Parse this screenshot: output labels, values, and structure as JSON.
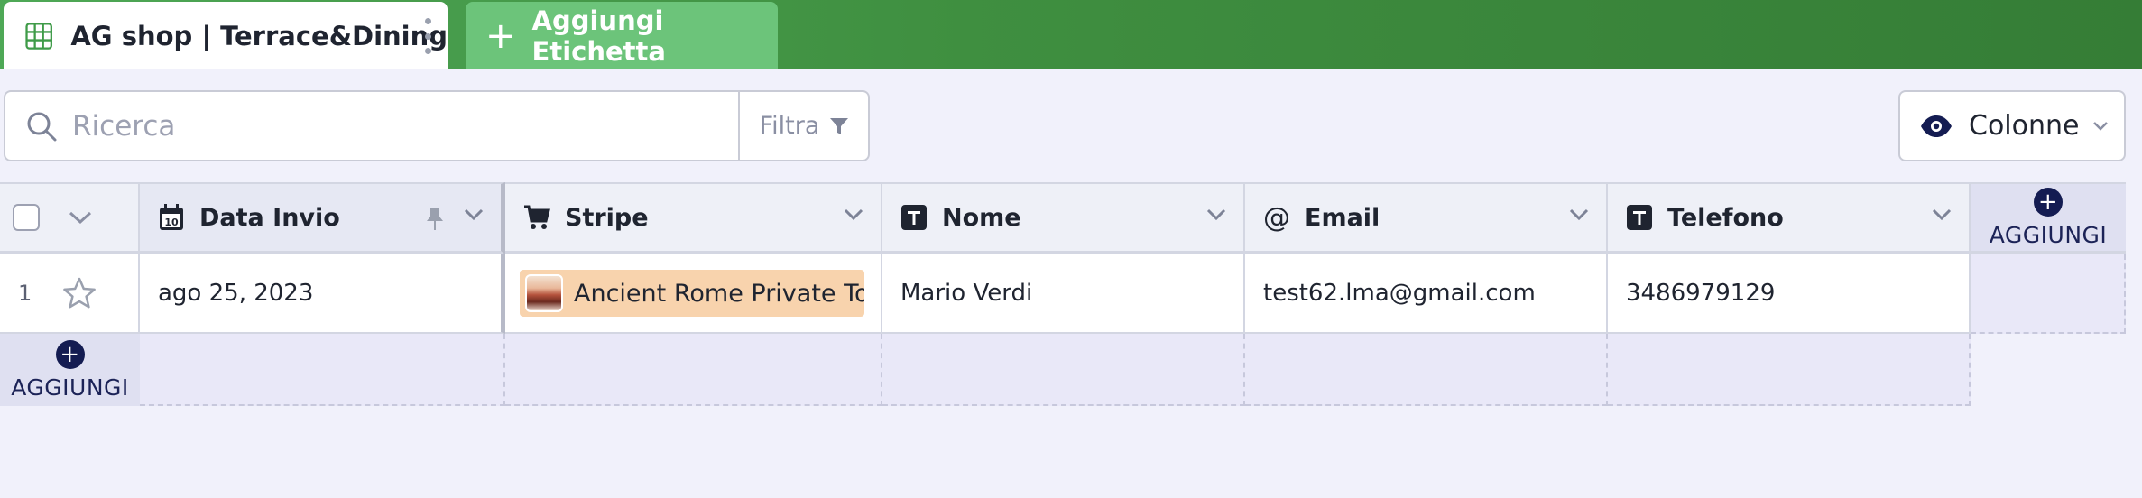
{
  "tabs": {
    "active_title": "AG shop | Terrace&Dining",
    "add_label": "Aggiungi Etichetta"
  },
  "toolbar": {
    "search_placeholder": "Ricerca",
    "filter_label": "Filtra",
    "columns_label": "Colonne"
  },
  "table": {
    "columns": [
      {
        "label": "Data Invio",
        "icon": "calendar-icon"
      },
      {
        "label": "Stripe",
        "icon": "cart-icon"
      },
      {
        "label": "Nome",
        "icon": "text-field-icon"
      },
      {
        "label": "Email",
        "icon": "at-icon"
      },
      {
        "label": "Telefono",
        "icon": "text-field-icon"
      }
    ],
    "add_column_label": "AGGIUNGI",
    "add_row_label": "AGGIUNGI",
    "rows": [
      {
        "number": "1",
        "data_invio": "ago 25, 2023",
        "stripe": "Ancient Rome Private Tour",
        "nome": "Mario Verdi",
        "email": "test62.lma@gmail.com",
        "telefono": "3486979129"
      }
    ]
  },
  "colors": {
    "tabbar_green": "#3f8f40",
    "add_tab_green": "#6cc47a",
    "accent_navy": "#141c52",
    "product_pill": "#f8d3ad"
  }
}
